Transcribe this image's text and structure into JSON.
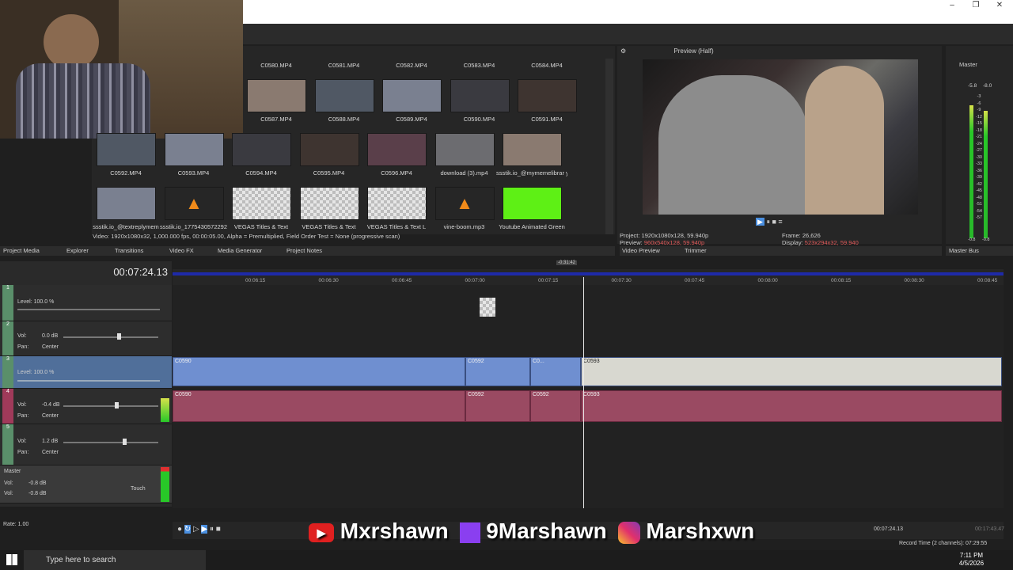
{
  "window": {
    "min": "–",
    "restore": "❐",
    "close": "✕"
  },
  "media": {
    "row0": [
      "C0580.MP4",
      "C0581.MP4",
      "C0582.MP4",
      "C0583.MP4",
      "C0584.MP4"
    ],
    "row1": [
      "C0587.MP4",
      "C0588.MP4",
      "C0589.MP4",
      "C0590.MP4",
      "C0591.MP4"
    ],
    "row2": [
      "C0592.MP4",
      "C0593.MP4",
      "C0594.MP4",
      "C0595.MP4",
      "C0596.MP4",
      "download (3).mp4",
      "ssstik.io_@mymemelibrar y_1775430606877.mp4"
    ],
    "row3": [
      "ssstik.io_@textreplymem",
      "ssstik.io_1775430572292",
      "VEGAS Titles & Text",
      "VEGAS Titles & Text",
      "VEGAS Titles & Text L",
      "vine-boom.mp3",
      "Youtube Animated Green"
    ],
    "status": "Video: 1920x1080x32, 1,000.000 fps, 00:00:05.00, Alpha = Premultiplied, Field Order Test = None (progressive scan)"
  },
  "preview": {
    "mode": "Preview (Half)",
    "project_label": "Project:",
    "project": "1920x1080x128, 59.940p",
    "preview_label": "Preview:",
    "preview": "960x540x128, 59.940p",
    "frame_label": "Frame:",
    "frame": "26,626",
    "display_label": "Display:",
    "display": "523x294x32, 59.940"
  },
  "masterbus": {
    "title": "Master",
    "scale": [
      "-3",
      "-6",
      "-9",
      "-12",
      "-15",
      "-18",
      "-21",
      "-24",
      "-27",
      "-30",
      "-33",
      "-36",
      "-39",
      "-42",
      "-45",
      "-48",
      "-51",
      "-54",
      "-57"
    ],
    "left": "-5.8",
    "right": "-8.0",
    "bl": "-0.8",
    "br": "-0.8"
  },
  "tabs": {
    "left": [
      "Project Media",
      "Explorer",
      "Transitions",
      "Video FX",
      "Media Generator",
      "Project Notes"
    ],
    "preview": [
      "Video Preview",
      "Trimmer"
    ],
    "master": "Master Bus"
  },
  "timeline": {
    "timecode": "00:07:24.13",
    "cursor_label": "-0:31:42",
    "ruler": [
      "00:06:15",
      "00:06:30",
      "00:06:45",
      "00:07:00",
      "00:07:15",
      "00:07:30",
      "00:07:45",
      "00:08:00",
      "00:08:15",
      "00:08:30",
      "00:08:45"
    ],
    "tracks": [
      {
        "num": "1",
        "l1": "Level: 100.0 %"
      },
      {
        "num": "2",
        "l1": "Vol:",
        "v1": "0.0 dB",
        "l2": "Pan:",
        "v2": "Center"
      },
      {
        "num": "3",
        "l1": "Level: 100.0 %"
      },
      {
        "num": "4",
        "l1": "Vol:",
        "v1": "-0.4 dB",
        "l2": "Pan:",
        "v2": "Center"
      },
      {
        "num": "5",
        "l1": "Vol:",
        "v1": "1.2 dB",
        "l2": "Pan:",
        "v2": "Center"
      }
    ],
    "master": {
      "name": "Master",
      "l1": "Vol:",
      "v1": "-0.8 dB",
      "l2": "Vol:",
      "v2": "-0.8 dB",
      "touch": "Touch"
    },
    "clips": {
      "v1": "C0590",
      "v2": "C0592",
      "v3": "C0...",
      "v4": "C0593",
      "a1": "C0590",
      "a2": "C0592",
      "a3": "C0592",
      "a4": "C0593"
    },
    "rate": "Rate: 1.00",
    "bottom_time": "00:07:24.13",
    "bottom_time2": "00:17:43.47",
    "record": "Record Time (2 channels): 07:29:55"
  },
  "social": {
    "yt": "Mxrshawn",
    "tw": "9Marshawn",
    "ig": "Marshxwn"
  },
  "taskbar": {
    "search": "Type here to search",
    "time": "7:11 PM",
    "date": "4/5/2026"
  }
}
